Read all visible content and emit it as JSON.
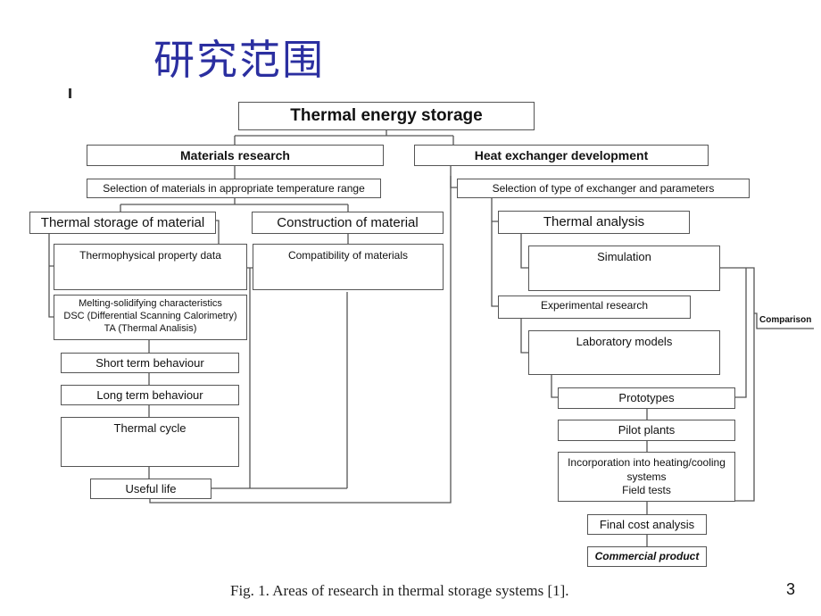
{
  "slide": {
    "title": "研究范围",
    "page_number": "3",
    "caption": "Fig. 1. Areas of research in thermal storage systems [1]."
  },
  "diagram": {
    "root": "Thermal energy storage",
    "materials": {
      "header": "Materials research",
      "selection": "Selection of materials in appropriate temperature range",
      "thermal_storage": "Thermal storage of material",
      "construction": "Construction of material",
      "thermophysical": "Thermophysical property data",
      "compatibility": "Compatibility of materials",
      "melting": [
        "Melting-solidifying characteristics",
        "DSC (Differential Scanning Calorimetry)",
        "TA (Thermal Analisis)"
      ],
      "short_term": "Short term behaviour",
      "long_term": "Long term behaviour",
      "thermal_cycle": "Thermal cycle",
      "useful_life": "Useful life"
    },
    "exchanger": {
      "header": "Heat exchanger development",
      "selection": "Selection of type of exchanger and parameters",
      "thermal_analysis": "Thermal analysis",
      "simulation": "Simulation",
      "experimental": "Experimental research",
      "lab_models": "Laboratory models",
      "prototypes": "Prototypes",
      "pilot_plants": "Pilot plants",
      "incorporation": [
        "Incorporation into heating/cooling",
        "systems",
        "Field tests"
      ],
      "final_cost": "Final cost analysis",
      "commercial": "Commercial product",
      "comparison": "Comparison"
    }
  }
}
